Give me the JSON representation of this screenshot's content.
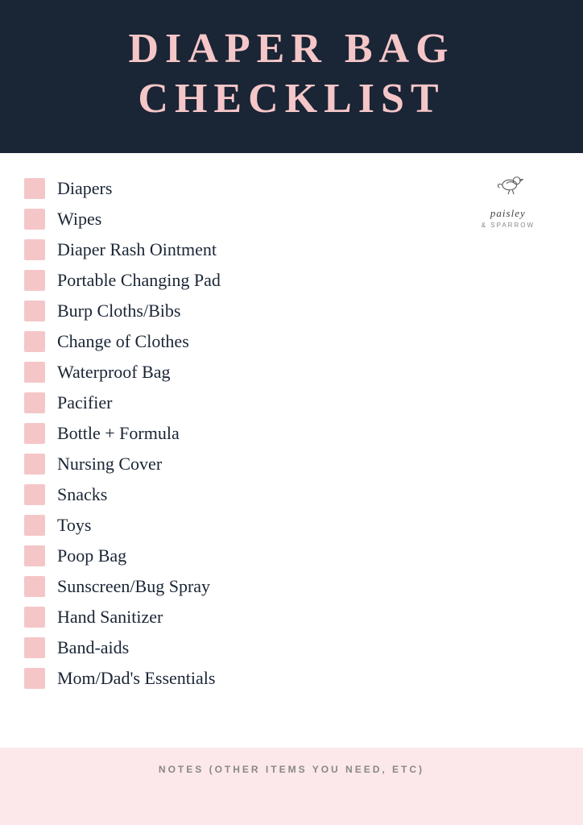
{
  "header": {
    "title_line1": "DIAPER BAG",
    "title_line2": "CHECKLIST"
  },
  "logo": {
    "brand": "paisley",
    "sub": "& SPARROW"
  },
  "checklist": {
    "items": [
      {
        "label": "Diapers"
      },
      {
        "label": "Wipes"
      },
      {
        "label": "Diaper Rash Ointment"
      },
      {
        "label": "Portable Changing Pad"
      },
      {
        "label": "Burp Cloths/Bibs"
      },
      {
        "label": "Change of Clothes"
      },
      {
        "label": "Waterproof Bag"
      },
      {
        "label": "Pacifier"
      },
      {
        "label": "Bottle + Formula"
      },
      {
        "label": "Nursing Cover"
      },
      {
        "label": "Snacks"
      },
      {
        "label": "Toys"
      },
      {
        "label": "Poop Bag"
      },
      {
        "label": "Sunscreen/Bug Spray"
      },
      {
        "label": "Hand Sanitizer"
      },
      {
        "label": "Band-aids"
      },
      {
        "label": "Mom/Dad's Essentials"
      }
    ]
  },
  "notes": {
    "label": "NOTES (OTHER ITEMS YOU NEED, ETC)"
  }
}
